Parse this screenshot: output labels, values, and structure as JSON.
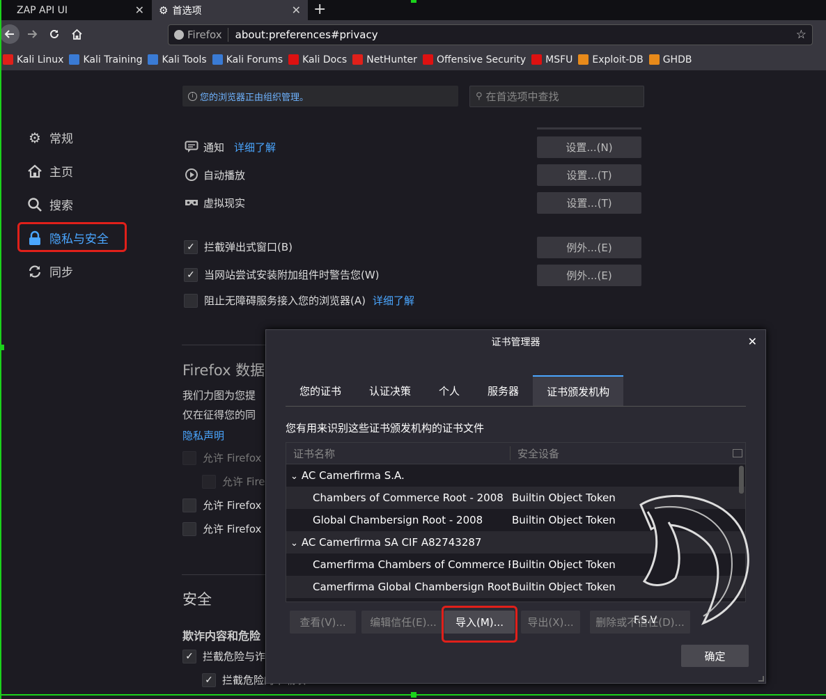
{
  "tabs": [
    {
      "label": "ZAP API UI",
      "close": "✕"
    },
    {
      "label": "首选项",
      "close": "✕"
    }
  ],
  "newtab": "+",
  "url": {
    "identity": "Firefox",
    "address": "about:preferences#privacy"
  },
  "bookmarks": [
    {
      "label": "Kali Linux",
      "color": "#e0201a"
    },
    {
      "label": "Kali Training",
      "color": "#3a7bd5"
    },
    {
      "label": "Kali Tools",
      "color": "#3a7bd5"
    },
    {
      "label": "Kali Forums",
      "color": "#3a7bd5"
    },
    {
      "label": "Kali Docs",
      "color": "#d11"
    },
    {
      "label": "NetHunter",
      "color": "#e0201a"
    },
    {
      "label": "Offensive Security",
      "color": "#d11"
    },
    {
      "label": "MSFU",
      "color": "#d11"
    },
    {
      "label": "Exploit-DB",
      "color": "#e88a1a"
    },
    {
      "label": "GHDB",
      "color": "#e88a1a"
    }
  ],
  "banner": "您的浏览器正由组织管理。",
  "search_placeholder": "在首选项中查找",
  "sidebar": {
    "items": [
      {
        "label": "常规"
      },
      {
        "label": "主页"
      },
      {
        "label": "搜索"
      },
      {
        "label": "隐私与安全"
      },
      {
        "label": "同步"
      }
    ]
  },
  "permissions": [
    {
      "label": "通知",
      "link": "详细了解",
      "button": "设置...(N)"
    },
    {
      "label": "自动播放",
      "button": "设置...(T)"
    },
    {
      "label": "虚拟现实",
      "button": "设置...(T)"
    }
  ],
  "checks": [
    {
      "label": "拦截弹出式窗口(B)",
      "button": "例外...(E)",
      "checked": true
    },
    {
      "label": "当网站尝试安装附加组件时警告您(W)",
      "button": "例外...(E)",
      "checked": true
    },
    {
      "label": "阻止无障碍服务接入您的浏览器(A)",
      "link": "详细了解",
      "checked": false
    }
  ],
  "data_section": {
    "heading": "Firefox 数据",
    "line1": "我们力图为您提",
    "line2": "仅在征得您的同",
    "privacy_link": "隐私声明",
    "allow1": "允许 Firefox",
    "allow1_sub": "允许 Fire",
    "allow2": "允许 Firefox",
    "allow3": "允许 Firefox"
  },
  "security": {
    "heading": "安全",
    "sub": "欺诈内容和危险",
    "check1": "拦截危险与诈",
    "check2": "拦截危险的下载项"
  },
  "dialog": {
    "title": "证书管理器",
    "close": "✕",
    "tabs": [
      "您的证书",
      "认证决策",
      "个人",
      "服务器",
      "证书颁发机构"
    ],
    "selected_tab": "证书颁发机构",
    "description": "您有用来识别这些证书颁发机构的证书文件",
    "columns": [
      "证书名称",
      "安全设备"
    ],
    "rows": [
      {
        "name": "AC Camerfirma S.A.",
        "device": "",
        "group": true
      },
      {
        "name": "Chambers of Commerce Root - 2008",
        "device": "Builtin Object Token",
        "group": false
      },
      {
        "name": "Global Chambersign Root - 2008",
        "device": "Builtin Object Token",
        "group": false
      },
      {
        "name": "AC Camerfirma SA CIF A82743287",
        "device": "",
        "group": true
      },
      {
        "name": "Camerfirma Chambers of Commerce R...",
        "device": "Builtin Object Token",
        "group": false
      },
      {
        "name": "Camerfirma Global Chambersign Root",
        "device": "Builtin Object Token",
        "group": false
      }
    ],
    "buttons": [
      "查看(V)...",
      "编辑信任(E)...",
      "导入(M)...",
      "导出(X)...",
      "删除或不信任(D)..."
    ],
    "ok": "确定"
  },
  "watermark": "F.S.V"
}
